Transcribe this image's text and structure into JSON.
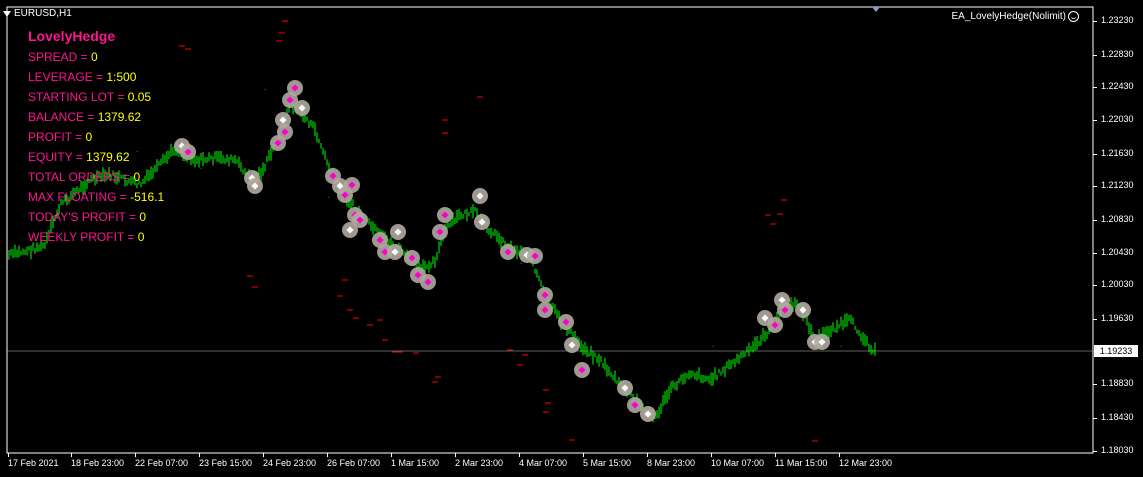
{
  "window": {
    "symbol": "EURUSD,H1",
    "expert": "EA_LovelyHedge(Nolimit)"
  },
  "panel": {
    "title": "LovelyHedge",
    "rows": [
      {
        "label": "SPREAD = ",
        "value": "0"
      },
      {
        "label": "LEVERAGE = ",
        "value": "1:500"
      },
      {
        "label": "STARTING LOT = ",
        "value": "0.05"
      },
      {
        "label": "BALANCE = ",
        "value": "1379.62"
      },
      {
        "label": "PROFIT =  ",
        "value": "0"
      },
      {
        "label": "EQUITY = ",
        "value": "1379.62"
      },
      {
        "label": "TOTAL ORDERS = ",
        "value": "0"
      },
      {
        "label": "MAX FLOATING = ",
        "value": "-516.1"
      },
      {
        "label": "TODAY'S PROFIT = ",
        "value": "0"
      },
      {
        "label": "WEEKLY PROFIT = ",
        "value": "0"
      }
    ]
  },
  "price_axis": {
    "labels": [
      "1.23230",
      "1.22830",
      "1.22430",
      "1.22030",
      "1.21630",
      "1.21230",
      "1.20830",
      "1.20430",
      "1.20030",
      "1.19630",
      "1.18830",
      "1.18430",
      "1.18030"
    ],
    "current_price": "1.19233"
  },
  "time_axis": {
    "labels": [
      "17 Feb 2021",
      "18 Feb 23:00",
      "22 Feb 07:00",
      "23 Feb 15:00",
      "24 Feb 23:00",
      "26 Feb 07:00",
      "1 Mar 15:00",
      "2 Mar 23:00",
      "4 Mar 07:00",
      "5 Mar 15:00",
      "8 Mar 23:00",
      "10 Mar 07:00",
      "11 Mar 15:00",
      "12 Mar 23:00"
    ]
  },
  "chart_data": {
    "type": "line",
    "symbol": "EURUSD",
    "timeframe": "H1",
    "ylim": [
      1.1797,
      1.2343
    ],
    "current_price": 1.19233,
    "x": [
      "17 Feb 2021",
      "18 Feb 23:00",
      "22 Feb 07:00",
      "23 Feb 15:00",
      "24 Feb 23:00",
      "26 Feb 07:00",
      "1 Mar 15:00",
      "2 Mar 23:00",
      "4 Mar 07:00",
      "5 Mar 15:00",
      "8 Mar 23:00",
      "10 Mar 07:00",
      "11 Mar 15:00",
      "12 Mar 23:00"
    ],
    "series": [
      {
        "values": [
          1.2045,
          1.2115,
          1.2165,
          1.2145,
          1.224,
          1.211,
          1.2055,
          1.209,
          1.203,
          1.193,
          1.185,
          1.193,
          1.1985,
          1.193
        ]
      }
    ],
    "colors": {
      "bars": "#00ff00",
      "markers": "#b0a8a0",
      "orders": "#ff0000"
    }
  }
}
